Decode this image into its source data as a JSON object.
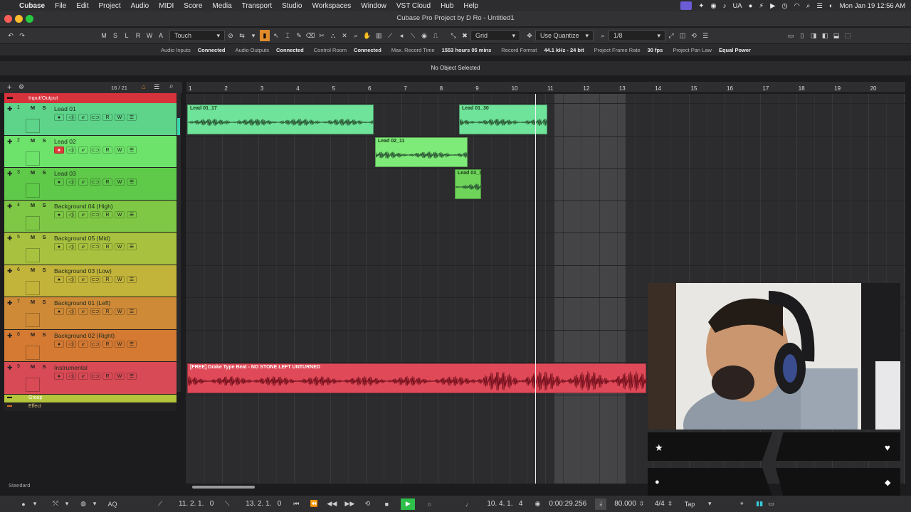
{
  "menubar": {
    "app": "Cubase",
    "items": [
      "File",
      "Edit",
      "Project",
      "Audio",
      "MIDI",
      "Score",
      "Media",
      "Transport",
      "Studio",
      "Workspaces",
      "Window",
      "VST Cloud",
      "Hub",
      "Help"
    ],
    "lang": "UA",
    "clock": "Mon Jan 19  12:56 AM"
  },
  "window": {
    "title": "Cubase Pro Project by D Ro - Untitled1"
  },
  "toolbar": {
    "ms": [
      "M",
      "S",
      "L",
      "R",
      "W",
      "A"
    ],
    "automation_mode": "Touch",
    "snap_type": "Grid",
    "quantize_mode": "Use Quantize",
    "quantize_value": "1/8"
  },
  "status": {
    "items": [
      {
        "label": "Audio Inputs",
        "value": "Connected"
      },
      {
        "label": "Audio Outputs",
        "value": "Connected"
      },
      {
        "label": "Control Room",
        "value": "Connected"
      },
      {
        "label": "Max. Record Time",
        "value": "1553 hours 05 mins"
      },
      {
        "label": "Record Format",
        "value": "44.1 kHz - 24 bit"
      },
      {
        "label": "Project Frame Rate",
        "value": "30 fps"
      },
      {
        "label": "Project Pan Law",
        "value": "Equal Power"
      }
    ]
  },
  "info": {
    "text": "No Object Selected"
  },
  "trackhead": {
    "count": "16 / 21"
  },
  "folder": {
    "input_output": "Input/Output",
    "group": "Group",
    "effect": "Effect"
  },
  "tracks": [
    {
      "num": "1",
      "name": "Lead 01",
      "color": "#5ed48a"
    },
    {
      "num": "2",
      "name": "Lead 02",
      "color": "#6ee36b"
    },
    {
      "num": "3",
      "name": "Lead 03",
      "color": "#5fc94a"
    },
    {
      "num": "4",
      "name": "Background 04 (High)",
      "color": "#7ec845"
    },
    {
      "num": "5",
      "name": "Background 05 (Mid)",
      "color": "#a8c23f"
    },
    {
      "num": "6",
      "name": "Background 03 (Low)",
      "color": "#c2b33a"
    },
    {
      "num": "7",
      "name": "Background 01 (Left)",
      "color": "#cf8a37"
    },
    {
      "num": "8",
      "name": "Background 02 (Right)",
      "color": "#d47a33"
    },
    {
      "num": "9",
      "name": "Instrumental",
      "color": "#d84a55"
    }
  ],
  "ruler": [
    "1",
    "2",
    "3",
    "4",
    "5",
    "6",
    "7",
    "8",
    "9",
    "10",
    "11",
    "12",
    "13",
    "14",
    "15",
    "16",
    "17",
    "18",
    "19",
    "20"
  ],
  "events": [
    {
      "name": "Lead 01_17",
      "color": "#6fe39a"
    },
    {
      "name": "Lead 01_30",
      "color": "#6fe39a"
    },
    {
      "name": "Lead 02_11",
      "color": "#7eea78"
    },
    {
      "name": "Lead 03_1",
      "color": "#6fd55a"
    },
    {
      "name": "[FREE] Drake Type Beat - NO STONE LEFT UNTURNED",
      "color": "#e04a58"
    }
  ],
  "footer": {
    "layout": "Standard",
    "left_locator": "11. 2. 1.   0",
    "right_locator": "13. 2. 1.   0",
    "position": "10. 4. 1.   4",
    "time": "0:00:29.256",
    "tempo": "80.000",
    "signature": "4/4",
    "tap": "Tap"
  },
  "colors": {
    "accent": "#f5a623",
    "selection": "#555"
  }
}
